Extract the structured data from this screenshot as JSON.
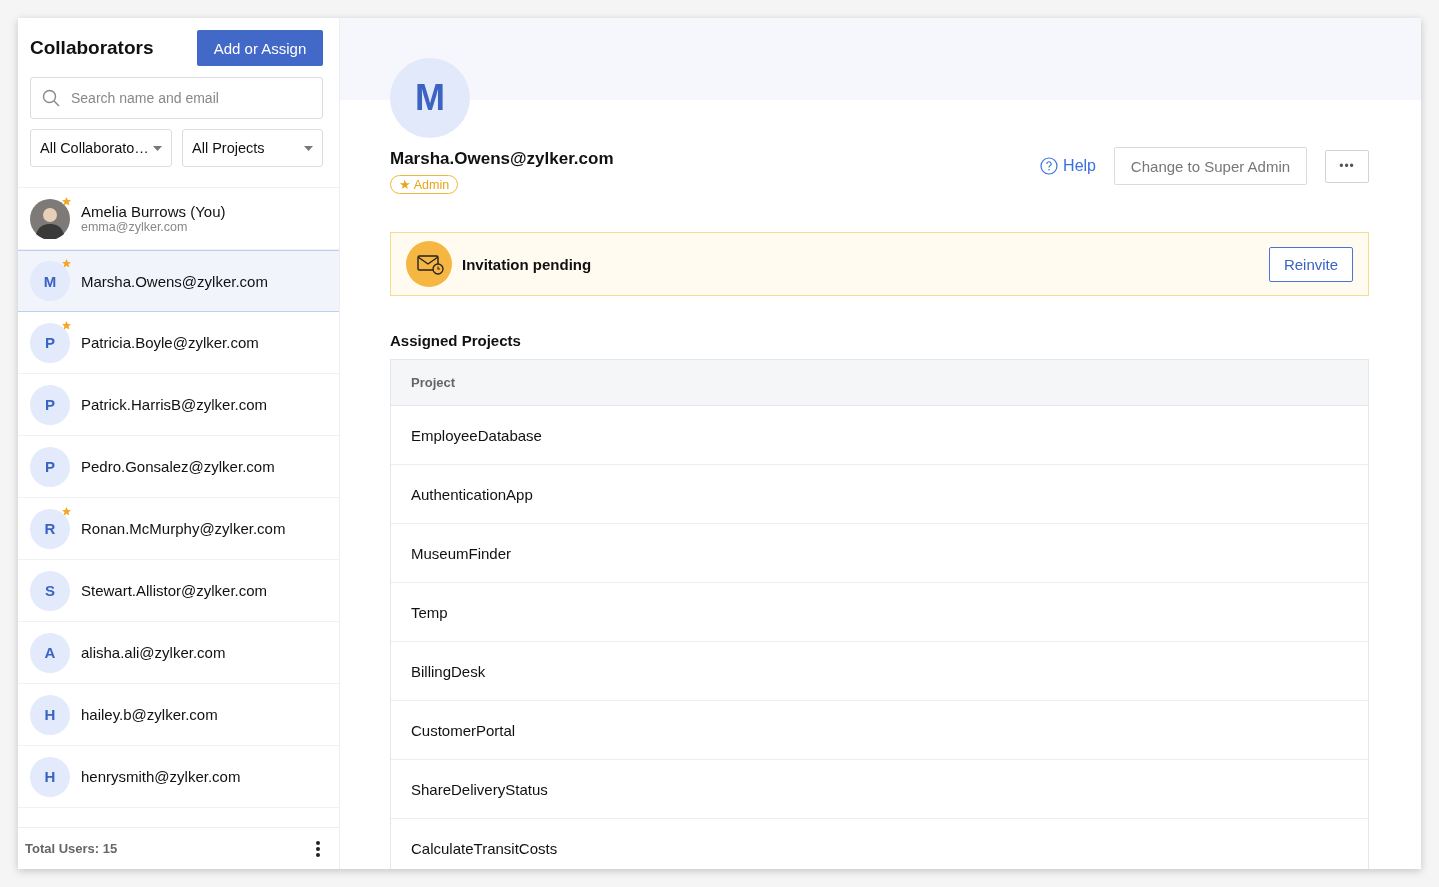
{
  "sidebar": {
    "title": "Collaborators",
    "add_button": "Add or Assign",
    "search": {
      "placeholder": "Search name and email"
    },
    "filters": [
      {
        "label": "All Collaborato…"
      },
      {
        "label": "All Projects"
      }
    ],
    "users": [
      {
        "kind": "photo",
        "name": "Amelia Burrows (You)",
        "email": "emma@zylker.com",
        "admin": true,
        "selected": false
      },
      {
        "kind": "initial",
        "initial": "M",
        "name": "Marsha.Owens@zylker.com",
        "admin": true,
        "selected": true
      },
      {
        "kind": "initial",
        "initial": "P",
        "name": "Patricia.Boyle@zylker.com",
        "admin": true,
        "selected": false
      },
      {
        "kind": "initial",
        "initial": "P",
        "name": "Patrick.HarrisB@zylker.com",
        "admin": false,
        "selected": false
      },
      {
        "kind": "initial",
        "initial": "P",
        "name": "Pedro.Gonsalez@zylker.com",
        "admin": false,
        "selected": false
      },
      {
        "kind": "initial",
        "initial": "R",
        "name": "Ronan.McMurphy@zylker.com",
        "admin": true,
        "selected": false
      },
      {
        "kind": "initial",
        "initial": "S",
        "name": "Stewart.Allistor@zylker.com",
        "admin": false,
        "selected": false
      },
      {
        "kind": "initial",
        "initial": "A",
        "name": "alisha.ali@zylker.com",
        "admin": false,
        "selected": false
      },
      {
        "kind": "initial",
        "initial": "H",
        "name": "hailey.b@zylker.com",
        "admin": false,
        "selected": false
      },
      {
        "kind": "initial",
        "initial": "H",
        "name": "henrysmith@zylker.com",
        "admin": false,
        "selected": false
      }
    ],
    "total": "Total Users: 15"
  },
  "profile": {
    "initial": "M",
    "email": "Marsha.Owens@zylker.com",
    "badge": "★ Admin",
    "help": "Help",
    "change_button": "Change to Super Admin",
    "more_button": "•••"
  },
  "banner": {
    "text": "Invitation pending",
    "button": "Reinvite"
  },
  "projects": {
    "title": "Assigned Projects",
    "column": "Project",
    "rows": [
      "EmployeeDatabase",
      "AuthenticationApp",
      "MuseumFinder",
      "Temp",
      "BillingDesk",
      "CustomerPortal",
      "ShareDeliveryStatus",
      "CalculateTransitCosts"
    ]
  }
}
